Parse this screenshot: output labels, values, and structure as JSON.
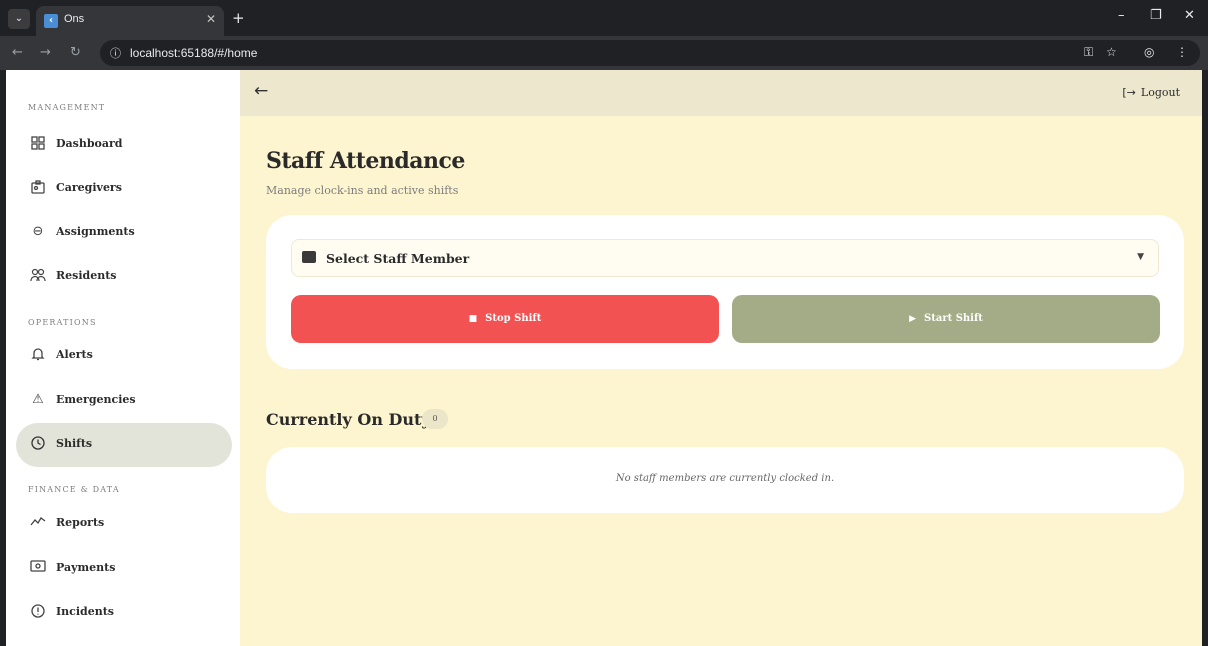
{
  "browser": {
    "tab_title": "Ons",
    "url": "localhost:65188/#/home"
  },
  "sidebar": {
    "sections": [
      {
        "label": "MANAGEMENT",
        "items": [
          "Dashboard",
          "Caregivers",
          "Assignments",
          "Residents"
        ]
      },
      {
        "label": "OPERATIONS",
        "items": [
          "Alerts",
          "Emergencies",
          "Shifts"
        ]
      },
      {
        "label": "FINANCE & DATA",
        "items": [
          "Reports",
          "Payments",
          "Incidents"
        ]
      }
    ],
    "active_item": "Shifts",
    "icons": {
      "Dashboard": "dashboard-icon",
      "Caregivers": "badge-icon",
      "Assignments": "link-icon",
      "Residents": "people-icon",
      "Alerts": "bell-icon",
      "Emergencies": "warning-icon",
      "Shifts": "clock-icon",
      "Reports": "trend-icon",
      "Payments": "cash-icon",
      "Incidents": "info-icon"
    }
  },
  "topbar": {
    "logout_label": "Logout"
  },
  "main": {
    "title": "Staff Attendance",
    "subtitle": "Manage clock-ins and active shifts",
    "select_placeholder": "Select Staff Member",
    "stop_label": "Stop Shift",
    "start_label": "Start Shift",
    "on_duty_title": "Currently On Duty",
    "on_duty_count": "0",
    "empty_message": "No staff members are currently clocked in."
  },
  "colors": {
    "stop": "#f25252",
    "start": "#a3ac86",
    "page_bg": "#fdf5cf",
    "active_nav": "#e3e4d9"
  }
}
